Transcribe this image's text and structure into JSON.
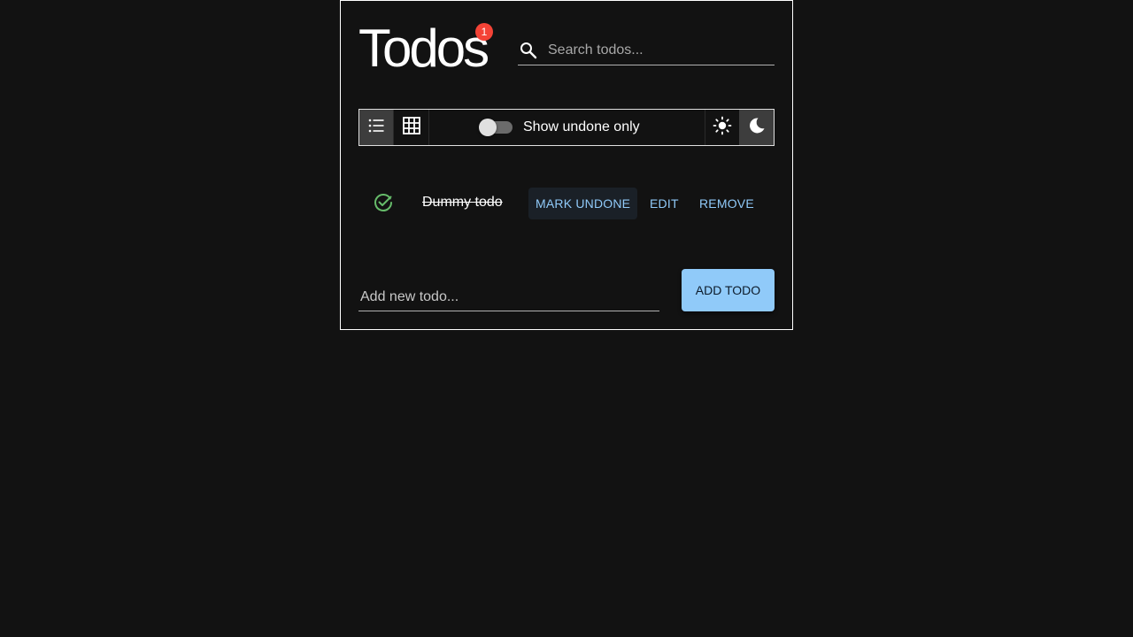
{
  "header": {
    "title": "Todos",
    "badge_count": "1"
  },
  "search": {
    "placeholder": "Search todos...",
    "icon": "search-icon"
  },
  "toolbar": {
    "view_list_icon": "list-view-icon",
    "view_grid_icon": "grid-view-icon",
    "active_view": "list",
    "toggle_label": "Show undone only",
    "toggle_on": false,
    "light_theme_icon": "sun-icon",
    "dark_theme_icon": "moon-icon",
    "active_theme": "dark"
  },
  "todos": [
    {
      "text": "Dummy todo",
      "done": true,
      "status_icon": "check-circle-icon",
      "mark_label": "MARK UNDONE",
      "edit_label": "EDIT",
      "remove_label": "REMOVE"
    }
  ],
  "add": {
    "placeholder": "Add new todo...",
    "button_label": "ADD TODO"
  },
  "colors": {
    "background": "#121212",
    "accent": "#90caf9",
    "badge": "#f44336",
    "success": "#66bb6a"
  }
}
